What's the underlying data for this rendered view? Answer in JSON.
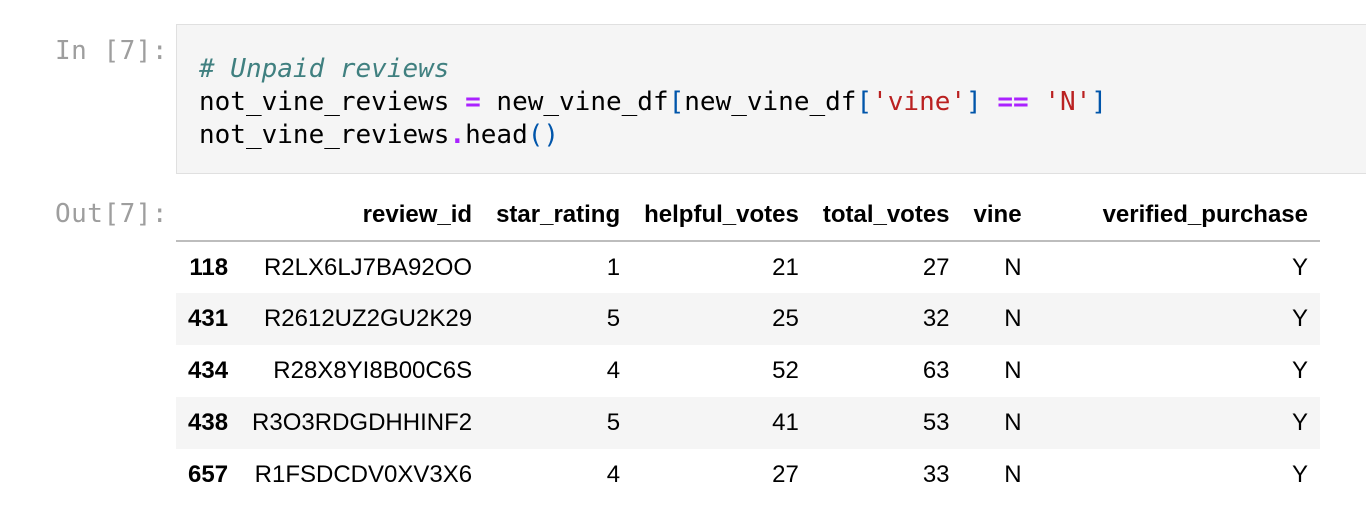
{
  "input_cell": {
    "prompt": "In [7]:",
    "code_lines": [
      [
        {
          "t": "comment",
          "v": "# Unpaid reviews"
        }
      ],
      [
        {
          "t": "plain",
          "v": "not_vine_reviews "
        },
        {
          "t": "op",
          "v": "="
        },
        {
          "t": "plain",
          "v": " new_vine_df"
        },
        {
          "t": "bracket",
          "v": "["
        },
        {
          "t": "plain",
          "v": "new_vine_df"
        },
        {
          "t": "bracket",
          "v": "["
        },
        {
          "t": "str",
          "v": "'vine'"
        },
        {
          "t": "bracket",
          "v": "]"
        },
        {
          "t": "plain",
          "v": " "
        },
        {
          "t": "op",
          "v": "=="
        },
        {
          "t": "plain",
          "v": " "
        },
        {
          "t": "str",
          "v": "'N'"
        },
        {
          "t": "bracket",
          "v": "]"
        }
      ],
      [
        {
          "t": "plain",
          "v": "not_vine_reviews"
        },
        {
          "t": "op",
          "v": "."
        },
        {
          "t": "plain",
          "v": "head"
        },
        {
          "t": "bracket",
          "v": "()"
        }
      ]
    ]
  },
  "output_cell": {
    "prompt": "Out[7]:",
    "table": {
      "index_header": "",
      "columns": [
        "review_id",
        "star_rating",
        "helpful_votes",
        "total_votes",
        "vine",
        "verified_purchase"
      ],
      "rows": [
        {
          "index": "118",
          "cells": [
            "R2LX6LJ7BA92OO",
            "1",
            "21",
            "27",
            "N",
            "Y"
          ]
        },
        {
          "index": "431",
          "cells": [
            "R2612UZ2GU2K29",
            "5",
            "25",
            "32",
            "N",
            "Y"
          ]
        },
        {
          "index": "434",
          "cells": [
            "R28X8YI8B00C6S",
            "4",
            "52",
            "63",
            "N",
            "Y"
          ]
        },
        {
          "index": "438",
          "cells": [
            "R3O3RDGDHHINF2",
            "5",
            "41",
            "53",
            "N",
            "Y"
          ]
        },
        {
          "index": "657",
          "cells": [
            "R1FSDCDV0XV3X6",
            "4",
            "27",
            "33",
            "N",
            "Y"
          ]
        }
      ]
    }
  }
}
